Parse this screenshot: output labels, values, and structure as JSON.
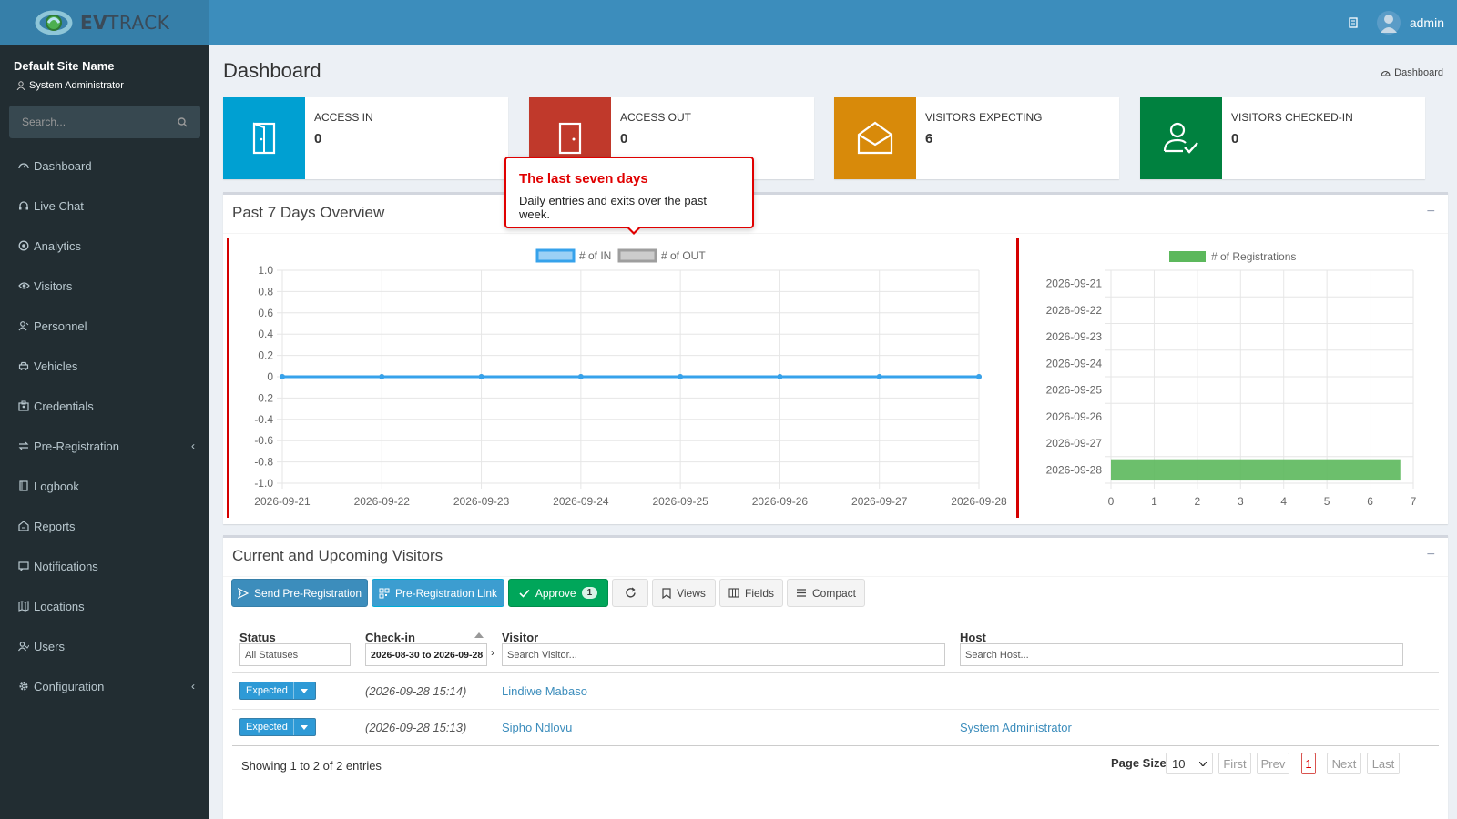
{
  "app": {
    "logo_text_bold": "EV",
    "logo_text_light": "TRACK",
    "user": "admin"
  },
  "sidebar": {
    "site_name": "Default Site Name",
    "role": "System Administrator",
    "search_placeholder": "Search...",
    "items": [
      {
        "label": "Dashboard",
        "icon": "dashboard-icon"
      },
      {
        "label": "Live Chat",
        "icon": "headset-icon"
      },
      {
        "label": "Analytics",
        "icon": "analytics-icon"
      },
      {
        "label": "Visitors",
        "icon": "eye-icon"
      },
      {
        "label": "Personnel",
        "icon": "personnel-icon"
      },
      {
        "label": "Vehicles",
        "icon": "car-icon"
      },
      {
        "label": "Credentials",
        "icon": "credentials-icon"
      },
      {
        "label": "Pre-Registration",
        "icon": "exchange-icon"
      },
      {
        "label": "Logbook",
        "icon": "book-icon"
      },
      {
        "label": "Reports",
        "icon": "reports-icon"
      },
      {
        "label": "Notifications",
        "icon": "message-icon"
      },
      {
        "label": "Locations",
        "icon": "map-icon"
      },
      {
        "label": "Users",
        "icon": "users-icon"
      },
      {
        "label": "Configuration",
        "icon": "gear-icon"
      }
    ]
  },
  "header": {
    "title": "Dashboard",
    "breadcrumb": "Dashboard"
  },
  "info_boxes": [
    {
      "label": "ACCESS IN",
      "value": "0",
      "color": "#00a0d2"
    },
    {
      "label": "ACCESS OUT",
      "value": "0",
      "color": "#c0392b"
    },
    {
      "label": "VISITORS EXPECTING",
      "value": "6",
      "color": "#e08e0b"
    },
    {
      "label": "VISITORS CHECKED-IN",
      "value": "0",
      "color": "#00813f"
    }
  ],
  "overview": {
    "title": "Past 7 Days Overview",
    "collapse": "−"
  },
  "tooltip": {
    "title": "The last seven days",
    "body": "Daily entries and exits over the past week."
  },
  "chart_data": [
    {
      "type": "line",
      "x": [
        "2026-09-21",
        "2026-09-22",
        "2026-09-23",
        "2026-09-24",
        "2026-09-25",
        "2026-09-26",
        "2026-09-27",
        "2026-09-28"
      ],
      "series": [
        {
          "name": "# of IN",
          "values": [
            0,
            0,
            0,
            0,
            0,
            0,
            0,
            0
          ],
          "color": "#36a2eb"
        },
        {
          "name": "# of OUT",
          "values": [
            0,
            0,
            0,
            0,
            0,
            0,
            0,
            0
          ],
          "color": "#9e9e9e"
        }
      ],
      "yticks": [
        "1.0",
        "0.8",
        "0.6",
        "0.4",
        "0.2",
        "0",
        "-0.2",
        "-0.4",
        "-0.6",
        "-0.8",
        "-1.0"
      ],
      "ylim": [
        -1.0,
        1.0
      ],
      "grid": true,
      "legend": "top"
    },
    {
      "type": "bar",
      "orientation": "horizontal",
      "categories": [
        "2026-09-21",
        "2026-09-22",
        "2026-09-23",
        "2026-09-24",
        "2026-09-25",
        "2026-09-26",
        "2026-09-27",
        "2026-09-28"
      ],
      "series": [
        {
          "name": "# of Registrations",
          "values": [
            0,
            0,
            0,
            0,
            0,
            0,
            0,
            6.7
          ],
          "color": "#5cb85c"
        }
      ],
      "xticks": [
        "0",
        "1",
        "2",
        "3",
        "4",
        "5",
        "6",
        "7"
      ],
      "xlim": [
        0,
        7
      ],
      "grid": true,
      "legend": "top"
    }
  ],
  "visitors": {
    "title": "Current and Upcoming Visitors",
    "collapse": "−",
    "buttons": {
      "send_prereg": "Send Pre-Registration",
      "prereg_link": "Pre-Registration Link",
      "approve": "Approve",
      "approve_count": "1",
      "views": "Views",
      "fields": "Fields",
      "compact": "Compact"
    },
    "columns": {
      "status": "Status",
      "checkin": "Check-in",
      "visitor": "Visitor",
      "host": "Host"
    },
    "filters": {
      "status": "All Statuses",
      "checkin": "2026-08-30 to 2026-09-28",
      "visitor_placeholder": "Search Visitor...",
      "host_placeholder": "Search Host..."
    },
    "rows": [
      {
        "status": "Expected",
        "checkin": "(2026-09-28 15:14)",
        "visitor": "Lindiwe Mabaso",
        "host": ""
      },
      {
        "status": "Expected",
        "checkin": "(2026-09-28 15:13)",
        "visitor": "Sipho Ndlovu",
        "host": "System Administrator"
      }
    ],
    "footer": {
      "showing": "Showing 1 to 2 of 2 entries",
      "page_size_label": "Page Size",
      "page_size": "10",
      "first": "First",
      "prev": "Prev",
      "page": "1",
      "next": "Next",
      "last": "Last"
    }
  }
}
